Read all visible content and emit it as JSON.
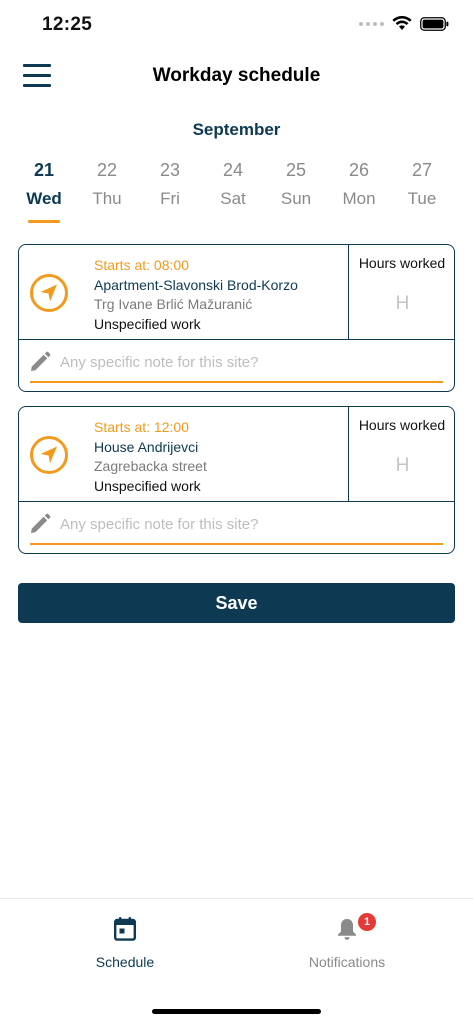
{
  "status_bar": {
    "time": "12:25"
  },
  "header": {
    "title": "Workday schedule"
  },
  "calendar": {
    "month": "September",
    "days": [
      {
        "num": "21",
        "name": "Wed",
        "active": true
      },
      {
        "num": "22",
        "name": "Thu",
        "active": false
      },
      {
        "num": "23",
        "name": "Fri",
        "active": false
      },
      {
        "num": "24",
        "name": "Sat",
        "active": false
      },
      {
        "num": "25",
        "name": "Sun",
        "active": false
      },
      {
        "num": "26",
        "name": "Mon",
        "active": false
      },
      {
        "num": "27",
        "name": "Tue",
        "active": false
      }
    ]
  },
  "sites": [
    {
      "starts": "Starts at: 08:00",
      "name": "Apartment-Slavonski Brod-Korzo",
      "address": "Trg Ivane Brlić Mažuranić",
      "work": "Unspecified work",
      "hours_label": "Hours worked",
      "hours_placeholder": "H",
      "note_placeholder": "Any specific note for this site?"
    },
    {
      "starts": "Starts at: 12:00",
      "name": "House Andrijevci",
      "address": "Zagrebacka street",
      "work": "Unspecified work",
      "hours_label": "Hours worked",
      "hours_placeholder": "H",
      "note_placeholder": "Any specific note for this site?"
    }
  ],
  "actions": {
    "save_label": "Save"
  },
  "tabs": {
    "schedule": {
      "label": "Schedule"
    },
    "notifications": {
      "label": "Notifications",
      "badge": "1"
    }
  },
  "colors": {
    "primary": "#0d3a52",
    "accent": "#f39a1d",
    "badge": "#e53935",
    "muted": "#8a8a8a"
  },
  "icons": {
    "menu": "hamburger-menu-icon",
    "navigate": "navigation-arrow-icon",
    "note": "pencil-icon",
    "schedule": "calendar-icon",
    "notifications": "bell-icon",
    "wifi": "wifi-icon",
    "battery": "battery-icon"
  }
}
